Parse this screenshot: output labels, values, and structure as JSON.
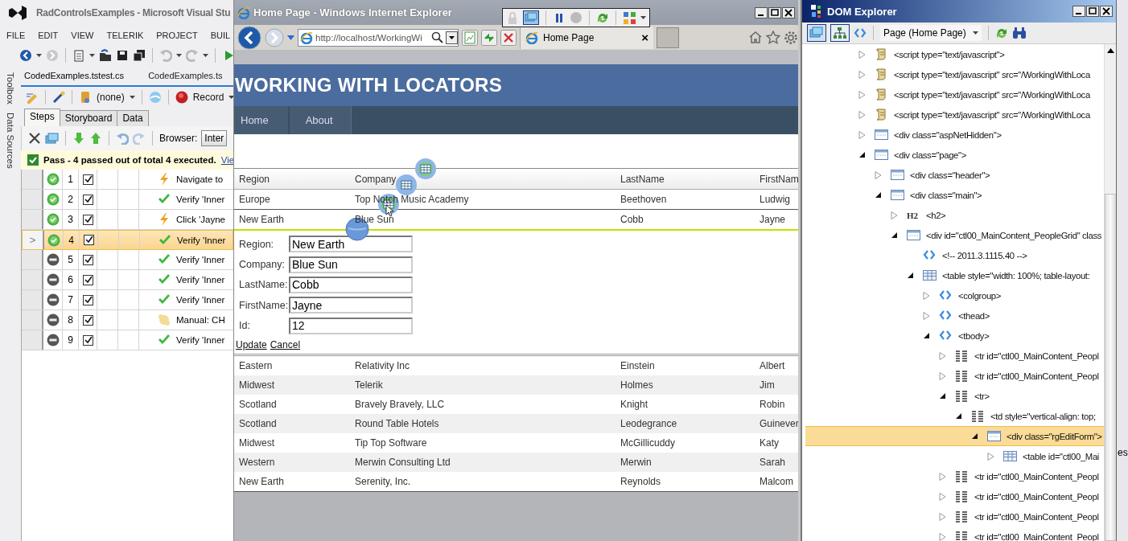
{
  "vs": {
    "title": "RadControlsExamples - Microsoft Visual Stu",
    "menu": [
      "FILE",
      "EDIT",
      "VIEW",
      "TELERIK",
      "PROJECT",
      "BUIL"
    ],
    "side_tabs": [
      "Toolbox",
      "Data Sources"
    ],
    "doc_tabs": [
      {
        "label": "CodedExamples.tstest.cs",
        "selected": true
      },
      {
        "label": "CodedExamples.ts",
        "selected": false
      }
    ],
    "toolbar": {
      "config": "(none)",
      "record": "Record"
    },
    "panel_tabs": [
      {
        "label": "Steps",
        "selected": true
      },
      {
        "label": "Storyboard",
        "selected": false
      },
      {
        "label": "Data",
        "selected": false
      }
    ],
    "browser_label": "Browser:",
    "browser_value": "Inter",
    "result": {
      "passed": true,
      "text": "Pass - 4 passed out of total 4 executed.",
      "link": "Vie"
    },
    "steps": [
      {
        "number": "1",
        "passed": true,
        "enabled": true,
        "kind": "navigate",
        "text": "Navigate to",
        "selected": false
      },
      {
        "number": "2",
        "passed": true,
        "enabled": true,
        "kind": "verify",
        "text": "Verify 'Inner",
        "selected": false
      },
      {
        "number": "3",
        "passed": true,
        "enabled": true,
        "kind": "navigate",
        "text": "Click 'Jayne",
        "selected": false
      },
      {
        "number": "4",
        "passed": true,
        "enabled": true,
        "kind": "verify",
        "text": "Verify 'Inner",
        "selected": true,
        "marker": ">"
      },
      {
        "number": "5",
        "passed": false,
        "enabled": true,
        "kind": "verify",
        "text": "Verify 'Inner",
        "selected": false
      },
      {
        "number": "6",
        "passed": false,
        "enabled": true,
        "kind": "verify",
        "text": "Verify 'Inner",
        "selected": false
      },
      {
        "number": "7",
        "passed": false,
        "enabled": true,
        "kind": "verify",
        "text": "Verify 'Inner",
        "selected": false
      },
      {
        "number": "8",
        "passed": false,
        "enabled": true,
        "kind": "manual",
        "text": "Manual: CH",
        "selected": false
      },
      {
        "number": "9",
        "passed": false,
        "enabled": true,
        "kind": "verify",
        "text": "Verify 'Inner",
        "selected": false
      }
    ]
  },
  "ie": {
    "title": "Home Page - Windows Internet Explorer",
    "address": "http://localhost/WorkingWi",
    "tab": "Home Page",
    "tab_close": "×",
    "site": {
      "heading": "WORKING WITH LOCATORS",
      "nav": [
        "Home",
        "About"
      ]
    },
    "grid": {
      "columns": [
        "Region",
        "Company",
        "LastName",
        "FirstNam"
      ],
      "rows_before": [
        {
          "cells": [
            "Europe",
            "Top Notch Music Academy",
            "Beethoven",
            "Ludwig"
          ],
          "editing": false
        },
        {
          "cells": [
            "New Earth",
            "Blue Sun",
            "Cobb",
            "Jayne"
          ],
          "editing": true
        }
      ],
      "edit_form": {
        "fields": [
          {
            "label": "Region:",
            "value": "New Earth"
          },
          {
            "label": "Company:",
            "value": "Blue Sun"
          },
          {
            "label": "LastName:",
            "value": "Cobb"
          },
          {
            "label": "FirstName:",
            "value": "Jayne"
          },
          {
            "label": "Id:",
            "value": "12"
          }
        ],
        "actions": [
          "Update",
          "Cancel"
        ]
      },
      "rows_after": [
        {
          "cells": [
            "Eastern",
            "Relativity Inc",
            "Einstein",
            "Albert"
          ],
          "editing": false
        },
        {
          "cells": [
            "Midwest",
            "Telerik",
            "Holmes",
            "Jim"
          ],
          "editing": false
        },
        {
          "cells": [
            "Scotland",
            "Bravely Bravely, LLC",
            "Knight",
            "Robin"
          ],
          "editing": false
        },
        {
          "cells": [
            "Scotland",
            "Round Table Hotels",
            "Leodegrance",
            "Guinever"
          ],
          "editing": false
        },
        {
          "cells": [
            "Midwest",
            "Tip Top Software",
            "McGillicuddy",
            "Katy"
          ],
          "editing": false
        },
        {
          "cells": [
            "Western",
            "Merwin Consulting Ltd",
            "Merwin",
            "Sarah"
          ],
          "editing": false
        },
        {
          "cells": [
            "New Earth",
            "Serenity, Inc.",
            "Reynolds",
            "Malcom"
          ],
          "editing": false
        }
      ]
    }
  },
  "dom": {
    "title": "DOM Explorer",
    "page_select": "Page (Home Page)",
    "tree": [
      {
        "kind": "script",
        "text": "<script type=\"text/javascript\">",
        "toggle": true,
        "expanded": false,
        "selected": false
      },
      {
        "kind": "script",
        "text": "<script type=\"text/javascript\" src=\"/WorkingWithLoca",
        "toggle": true,
        "expanded": false,
        "selected": false
      },
      {
        "kind": "script",
        "text": "<script type=\"text/javascript\" src=\"/WorkingWithLoca",
        "toggle": true,
        "expanded": false,
        "selected": false
      },
      {
        "kind": "script",
        "text": "<script type=\"text/javascript\" src=\"/WorkingWithLoca",
        "toggle": true,
        "expanded": false,
        "selected": false
      },
      {
        "kind": "div",
        "text": "<div class=\"aspNetHidden\">",
        "toggle": true,
        "expanded": false,
        "selected": false
      },
      {
        "kind": "div",
        "text": "<div class=\"page\">",
        "toggle": true,
        "expanded": true,
        "selected": false,
        "children": [
          {
            "kind": "div",
            "text": "<div class=\"header\">",
            "toggle": true,
            "expanded": false,
            "selected": false
          },
          {
            "kind": "div",
            "text": "<div class=\"main\">",
            "toggle": true,
            "expanded": true,
            "selected": false,
            "children": [
              {
                "kind": "heading",
                "label": "H2",
                "text": "<h2>",
                "toggle": true,
                "expanded": false,
                "selected": false
              },
              {
                "kind": "div",
                "text": "<div id=\"ctl00_MainContent_PeopleGrid\" class",
                "toggle": true,
                "expanded": true,
                "selected": false,
                "children": [
                  {
                    "kind": "tag",
                    "text": "<!-- 2011.3.1115.40 -->",
                    "toggle": false,
                    "selected": false
                  },
                  {
                    "kind": "table",
                    "text": "<table style=\"width: 100%; table-layout:",
                    "toggle": true,
                    "expanded": true,
                    "selected": false,
                    "children": [
                      {
                        "kind": "tag",
                        "text": "<colgroup>",
                        "toggle": true,
                        "expanded": false,
                        "selected": false
                      },
                      {
                        "kind": "tag",
                        "text": "<thead>",
                        "toggle": true,
                        "expanded": false,
                        "selected": false
                      },
                      {
                        "kind": "tag",
                        "text": "<tbody>",
                        "toggle": true,
                        "expanded": true,
                        "selected": false,
                        "children": [
                          {
                            "kind": "row",
                            "text": "<tr id=\"ctl00_MainContent_Peopl",
                            "toggle": true,
                            "expanded": false,
                            "selected": false
                          },
                          {
                            "kind": "row",
                            "text": "<tr id=\"ctl00_MainContent_Peopl",
                            "toggle": true,
                            "expanded": false,
                            "selected": false
                          },
                          {
                            "kind": "row",
                            "text": "<tr>",
                            "toggle": true,
                            "expanded": true,
                            "selected": false,
                            "children": [
                              {
                                "kind": "row",
                                "text": "<td style=\"vertical-align: top;",
                                "toggle": true,
                                "expanded": true,
                                "selected": false,
                                "children": [
                                  {
                                    "kind": "div",
                                    "text": "<div class=\"rgEditForm\">",
                                    "toggle": true,
                                    "expanded": true,
                                    "selected": true,
                                    "children": [
                                      {
                                        "kind": "table",
                                        "text": "<table id=\"ctl00_Mai",
                                        "toggle": true,
                                        "expanded": false,
                                        "selected": false
                                      }
                                    ]
                                  }
                                ]
                              }
                            ]
                          },
                          {
                            "kind": "row",
                            "text": "<tr id=\"ctl00_MainContent_Peopl",
                            "toggle": true,
                            "expanded": false,
                            "selected": false
                          },
                          {
                            "kind": "row",
                            "text": "<tr id=\"ctl00_MainContent_Peopl",
                            "toggle": true,
                            "expanded": false,
                            "selected": false
                          },
                          {
                            "kind": "row",
                            "text": "<tr id=\"ctl00_MainContent_Peopl",
                            "toggle": true,
                            "expanded": false,
                            "selected": false
                          },
                          {
                            "kind": "row",
                            "text": "<tr id=\"ctl00_MainContent_Peopl",
                            "toggle": true,
                            "expanded": false,
                            "selected": false
                          }
                        ]
                      }
                    ]
                  }
                ]
              }
            ]
          }
        ]
      }
    ]
  },
  "strip": {
    "text": "es"
  }
}
